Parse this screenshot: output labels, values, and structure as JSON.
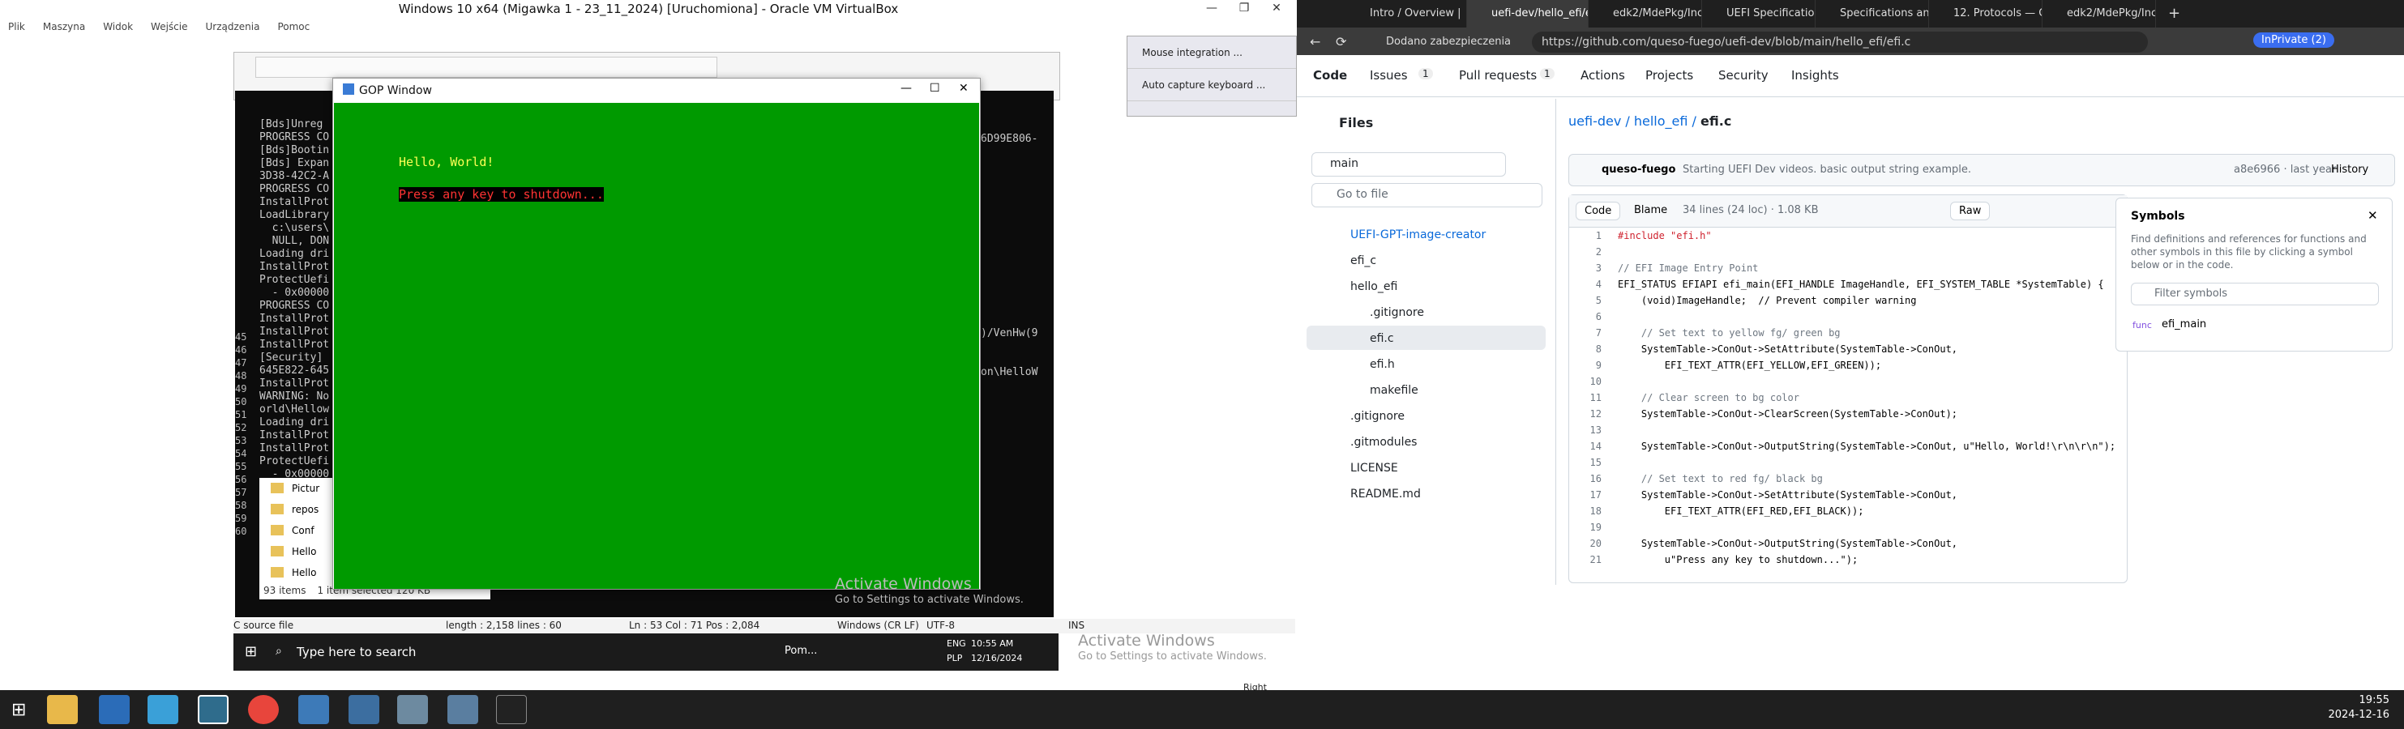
{
  "vbox": {
    "title": "Windows 10 x64 (Migawka 1 - 23_11_2024) [Uruchomiona] - Oracle VM VirtualBox",
    "menu": [
      "Plik",
      "Maszyna",
      "Widok",
      "Wejście",
      "Urządzenia",
      "Pomoc"
    ]
  },
  "gop": {
    "title": "GOP Window",
    "line1": "Hello, World!",
    "line2": "Press any key to shutdown..."
  },
  "console_lines": [
    "[Bds]Unreg",
    "PROGRESS CO",
    "[Bds]Bootin",
    "[Bds] Expan",
    "3D38-42C2-A",
    "PROGRESS CO",
    "InstallProt",
    "LoadLibrary",
    "  c:\\users\\",
    "  NULL, DON",
    "Loading dri",
    "InstallProt",
    "ProtectUefi",
    "  - 0x00000",
    "PROGRESS CO",
    "InstallProt",
    "InstallProt",
    "InstallProt",
    "[Security] ",
    "645E822-645",
    "InstallProt",
    "WARNING: No",
    "orld\\Hellow",
    "Loading dri",
    "InstallProt",
    "InstallProt",
    "ProtectUefi",
    "  - 0x00000",
    "InstallProt"
  ],
  "console_right": [
    "6D99E806-",
    ")/VenHw(9",
    "on\\HelloW"
  ],
  "line_numbers": [
    "45",
    "46",
    "47",
    "48",
    "49",
    "50",
    "51",
    "52",
    "53",
    "54",
    "55",
    "56",
    "57",
    "58",
    "59",
    "60"
  ],
  "explorer": {
    "items": [
      "Pictur",
      "repos",
      "Conf",
      "Hello",
      "Hello"
    ],
    "count": "93 items",
    "selected": "1 item selected  120 KB"
  },
  "editor_status": {
    "lang": "C source file",
    "length": "length : 2,158    lines : 60",
    "pos": "Ln : 53    Col : 71    Pos : 2,084",
    "eol": "Windows (CR LF)",
    "enc": "UTF-8",
    "ins": "INS"
  },
  "guest_taskbar": {
    "search": "Type here to search",
    "app": "Pom...",
    "lang": "ENG",
    "lang2": "PLP",
    "time": "10:55 AM",
    "date": "12/16/2024"
  },
  "watermark": {
    "title": "Activate Windows",
    "sub": "Go to Settings to activate Windows."
  },
  "right_panel": [
    "Mouse integration ...",
    "Auto capture keyboard ..."
  ],
  "host_right_ctrl": "Right Control",
  "host_clock": {
    "time": "19:55",
    "date": "2024-12-16"
  },
  "browser": {
    "tabs": [
      "Intro / Overview |",
      "uefi-dev/hello_efi/e",
      "edk2/MdePkg/Incl",
      "UEFI Specification",
      "Specifications and",
      "12. Protocols — C",
      "edk2/MdePkg/Incl"
    ],
    "secure": "Dodano zabezpieczenia",
    "url": "https://github.com/queso-fuego/uefi-dev/blob/main/hello_efi/efi.c",
    "inprivate": "InPrivate (2)"
  },
  "gh": {
    "nav": [
      "Code",
      "Issues",
      "1",
      "Pull requests",
      "1",
      "Actions",
      "Projects",
      "Security",
      "Insights"
    ],
    "files_title": "Files",
    "branch": "main",
    "goto": "Go to file",
    "breadcrumb_repo": "uefi-dev",
    "breadcrumb_dir": "hello_efi",
    "breadcrumb_file": "efi.c",
    "tree": [
      "UEFI-GPT-image-creator",
      "efi_c",
      "hello_efi",
      ".gitignore",
      "efi.c",
      "efi.h",
      "makefile",
      ".gitignore",
      ".gitmodules",
      "LICENSE",
      "README.md"
    ],
    "author": "queso-fuego",
    "commit_msg": "Starting UEFI Dev videos. basic output string example.",
    "commit_meta": "a8e6966 · last year",
    "history": "History",
    "code_tab": "Code",
    "blame_tab": "Blame",
    "file_info": "34 lines (24 loc) · 1.08 KB",
    "raw": "Raw",
    "symbols_title": "Symbols",
    "symbols_desc": "Find definitions and references for functions and other symbols in this file by clicking a symbol below or in the code.",
    "filter": "Filter symbols",
    "func_tag": "func",
    "func_name": "efi_main"
  },
  "code_lines": [
    {
      "n": "1",
      "t": "#include \"efi.h\""
    },
    {
      "n": "2",
      "t": ""
    },
    {
      "n": "3",
      "t": "// EFI Image Entry Point"
    },
    {
      "n": "4",
      "t": "EFI_STATUS EFIAPI efi_main(EFI_HANDLE ImageHandle, EFI_SYSTEM_TABLE *SystemTable) {"
    },
    {
      "n": "5",
      "t": "    (void)ImageHandle;  // Prevent compiler warning"
    },
    {
      "n": "6",
      "t": ""
    },
    {
      "n": "7",
      "t": "    // Set text to yellow fg/ green bg"
    },
    {
      "n": "8",
      "t": "    SystemTable->ConOut->SetAttribute(SystemTable->ConOut,"
    },
    {
      "n": "9",
      "t": "        EFI_TEXT_ATTR(EFI_YELLOW,EFI_GREEN));"
    },
    {
      "n": "10",
      "t": ""
    },
    {
      "n": "11",
      "t": "    // Clear screen to bg color"
    },
    {
      "n": "12",
      "t": "    SystemTable->ConOut->ClearScreen(SystemTable->ConOut);"
    },
    {
      "n": "13",
      "t": ""
    },
    {
      "n": "14",
      "t": "    SystemTable->ConOut->OutputString(SystemTable->ConOut, u\"Hello, World!\\r\\n\\r\\n\");"
    },
    {
      "n": "15",
      "t": ""
    },
    {
      "n": "16",
      "t": "    // Set text to red fg/ black bg"
    },
    {
      "n": "17",
      "t": "    SystemTable->ConOut->SetAttribute(SystemTable->ConOut,"
    },
    {
      "n": "18",
      "t": "        EFI_TEXT_ATTR(EFI_RED,EFI_BLACK));"
    },
    {
      "n": "19",
      "t": ""
    },
    {
      "n": "20",
      "t": "    SystemTable->ConOut->OutputString(SystemTable->ConOut,"
    },
    {
      "n": "21",
      "t": "        u\"Press any key to shutdown...\");"
    }
  ],
  "colors": {
    "gop_bg": "#009a00",
    "hello_fg": "#ffff55",
    "press_fg": "#ff3333",
    "link": "#0969da"
  }
}
